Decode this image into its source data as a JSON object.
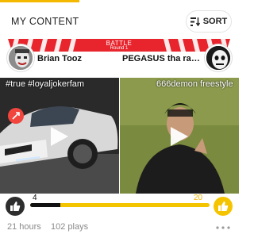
{
  "header": {
    "title": "MY CONTENT",
    "sort_label": "SORT"
  },
  "battle": {
    "label": "BATTLE",
    "round": "Round 1"
  },
  "competitors": {
    "left": {
      "name": "Brian Tooz"
    },
    "right": {
      "name": "PEGASUS tha rapp..."
    }
  },
  "tracks": {
    "left": {
      "title": "#true #loyaljokerfam"
    },
    "right": {
      "title": "666demon freestyle"
    }
  },
  "votes": {
    "left": "4",
    "right": "20",
    "left_share": 0.167
  },
  "meta": {
    "time": "21 hours",
    "plays": "102 plays"
  },
  "colors": {
    "accent": "#f5b800",
    "battle_red": "#e8242c",
    "vote_yellow": "#f5c400"
  },
  "icons": [
    "sort-icon",
    "play-icon",
    "thumbs-up-icon",
    "more-icon"
  ]
}
